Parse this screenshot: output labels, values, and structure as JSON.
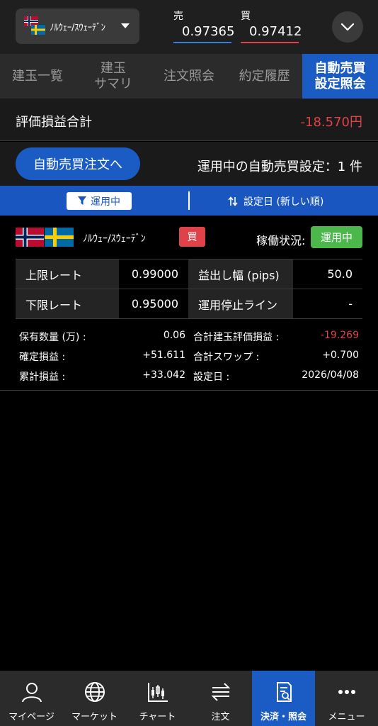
{
  "header": {
    "pair_label": "ﾉﾙｳｪｰ/ｽｳｪｰﾃﾞﾝ",
    "sell_label": "売",
    "sell_value": "0.97365",
    "buy_label": "買",
    "buy_value": "0.97412"
  },
  "tabs": [
    {
      "label": "建玉一覧"
    },
    {
      "label": "建玉\nサマリ"
    },
    {
      "label": "注文照会"
    },
    {
      "label": "約定履歴"
    },
    {
      "label": "自動売買\n設定照会",
      "active": true
    }
  ],
  "summary": {
    "label": "評価損益合計",
    "value": "-18.570円"
  },
  "order": {
    "button_label": "自動売買注文へ",
    "count_text": "運用中の自動売買設定：1 件"
  },
  "filter": {
    "chip_label": "運用中",
    "sort_label": "設定日 (新しい順)"
  },
  "card": {
    "pair_name": "ﾉﾙｳｪｰ/ｽｳｪｰﾃﾞﾝ",
    "side_badge": "買",
    "status_label": "稼働状況:",
    "status_value": "運用中",
    "grid": [
      {
        "l1": "上限レート",
        "v1": "0.99000",
        "l2": "益出し幅 (pips)",
        "v2": "50.0"
      },
      {
        "l1": "下限レート",
        "v1": "0.95000",
        "l2": "運用停止ライン",
        "v2": "-"
      }
    ],
    "stats": [
      {
        "l1": "保有数量 (万) :",
        "v1": "0.06",
        "l2": "合計建玉評価損益 :",
        "v2": "-19.269",
        "v2_neg": true
      },
      {
        "l1": "確定損益 :",
        "v1": "+51.611",
        "l2": "合計スワップ :",
        "v2": "+0.700"
      },
      {
        "l1": "累計損益 :",
        "v1": "+33.042",
        "l2": "設定日 :",
        "v2": "2026/04/08"
      }
    ]
  },
  "bottom_nav": [
    {
      "label": "マイページ",
      "icon": "person-icon"
    },
    {
      "label": "マーケット",
      "icon": "globe-icon"
    },
    {
      "label": "チャート",
      "icon": "candlestick-icon"
    },
    {
      "label": "注文",
      "icon": "arrows-icon"
    },
    {
      "label": "決済・照会",
      "icon": "document-search-icon",
      "active": true
    },
    {
      "label": "メニュー",
      "icon": "more-icon"
    }
  ],
  "colors": {
    "accent": "#1a5bc4",
    "negative": "#e0424a",
    "positive_badge": "#4cb84c"
  }
}
